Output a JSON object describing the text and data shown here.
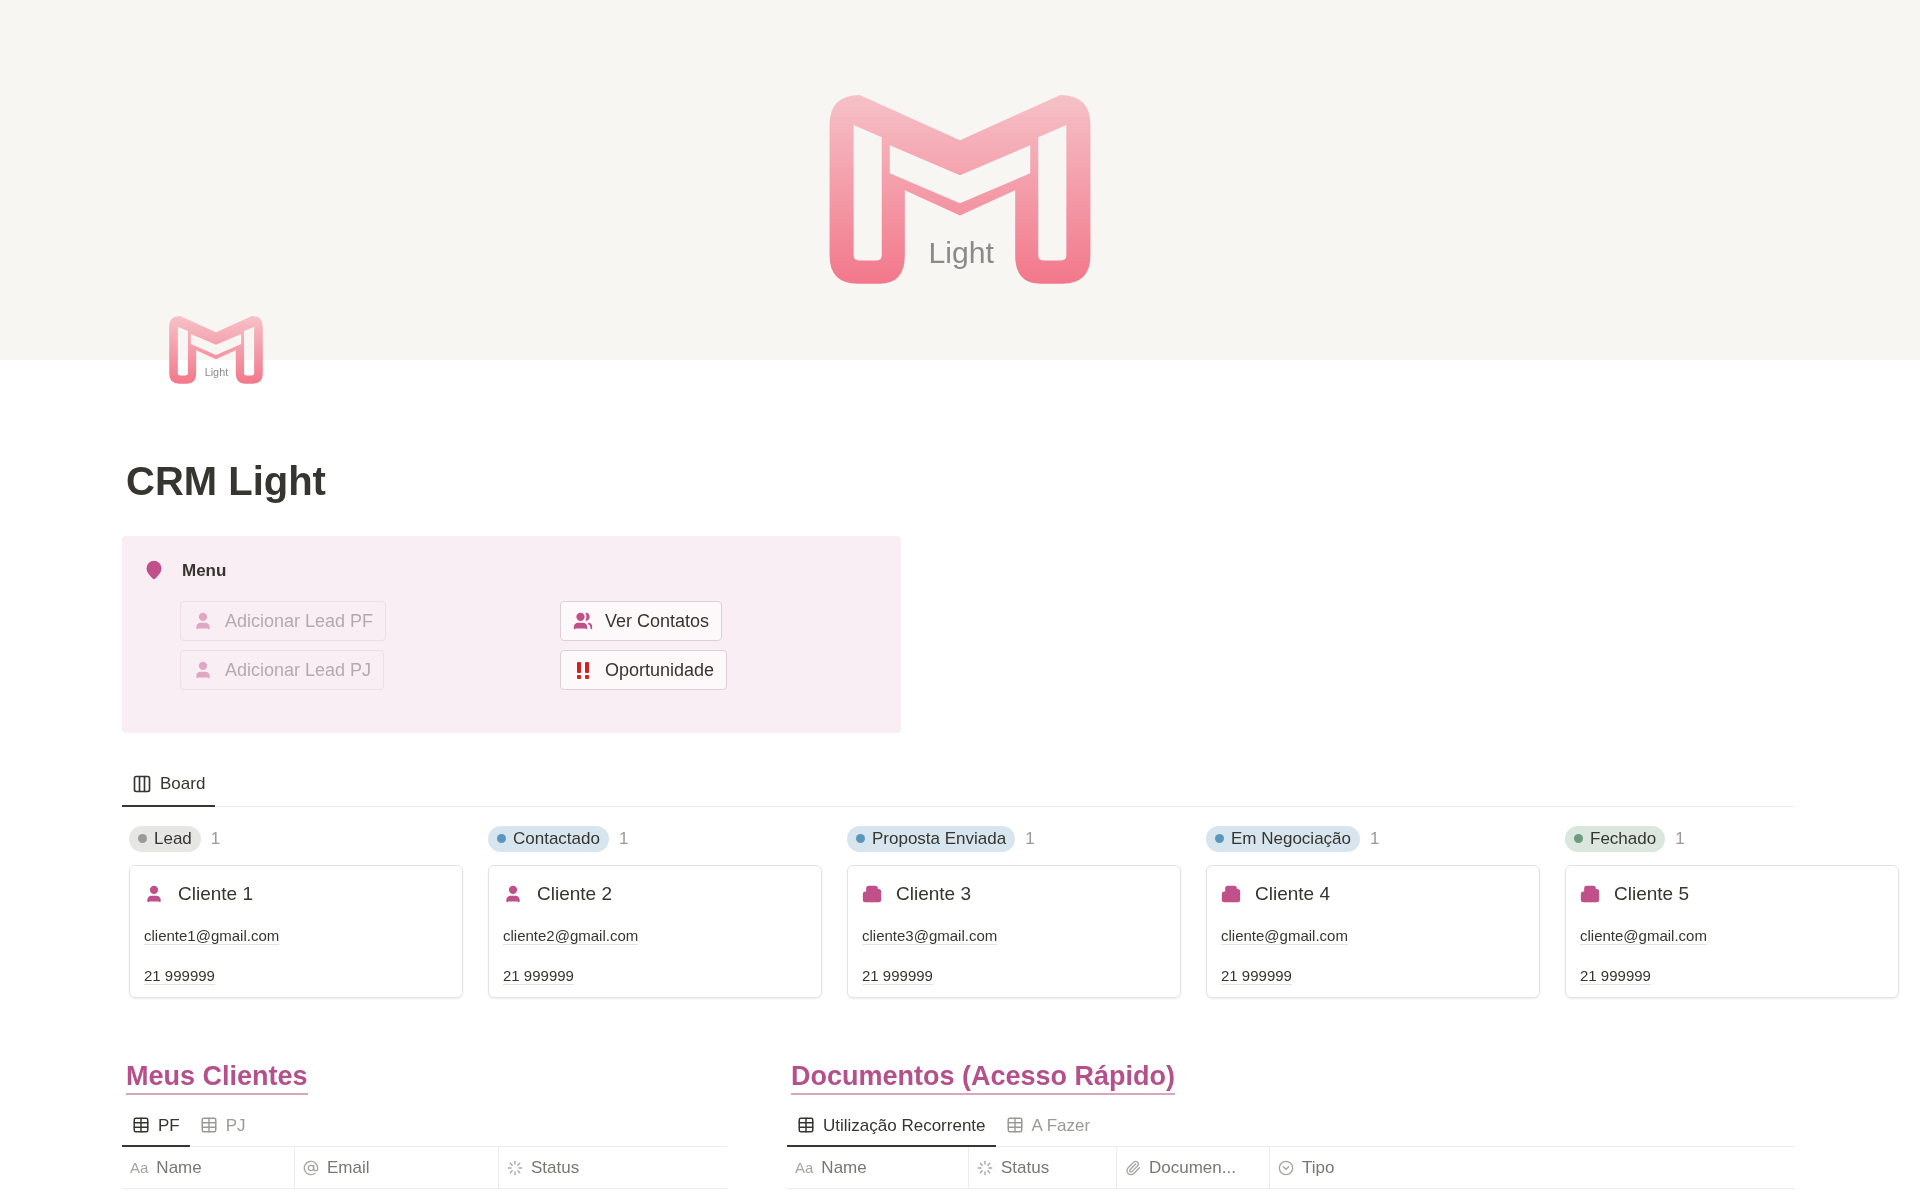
{
  "cover": {
    "logo_text": "Light"
  },
  "page_icon": {
    "logo_text": "Light"
  },
  "title": "CRM Light",
  "callout": {
    "title": "Menu",
    "buttons": [
      {
        "label": "Adicionar Lead PF",
        "kind": "person",
        "disabled": true
      },
      {
        "label": "Ver Contatos",
        "kind": "people",
        "disabled": false
      },
      {
        "label": "Adicionar Lead PJ",
        "kind": "person",
        "disabled": true
      },
      {
        "label": "Oportunidade",
        "kind": "alert",
        "disabled": false
      }
    ]
  },
  "board": {
    "tabs": [
      {
        "label": "Board",
        "selected": true
      }
    ],
    "columns": [
      {
        "status": "Lead",
        "color": "#9b9a97",
        "count": "1",
        "cards": [
          {
            "name": "Cliente 1",
            "kind": "person",
            "email": "cliente1@gmail.com",
            "phone": "21 999999"
          }
        ]
      },
      {
        "status": "Contactado",
        "color": "#5b97bd",
        "count": "1",
        "cards": [
          {
            "name": "Cliente 2",
            "kind": "person",
            "email": "cliente2@gmail.com",
            "phone": "21 999999"
          }
        ]
      },
      {
        "status": "Proposta Enviada",
        "color": "#5b97bd",
        "count": "1",
        "cards": [
          {
            "name": "Cliente 3",
            "kind": "building",
            "email": "cliente3@gmail.com",
            "phone": "21 999999"
          }
        ]
      },
      {
        "status": "Em Negociação",
        "color": "#5b97bd",
        "count": "1",
        "cards": [
          {
            "name": "Cliente 4",
            "kind": "building",
            "email": "cliente@gmail.com",
            "phone": "21 999999"
          }
        ]
      },
      {
        "status": "Fechado",
        "color": "#6c9b7d",
        "count": "1",
        "cards": [
          {
            "name": "Cliente 5",
            "kind": "building",
            "email": "cliente@gmail.com",
            "phone": "21 999999"
          }
        ]
      }
    ]
  },
  "sections": [
    {
      "title": "Meus Clientes",
      "tabs": [
        {
          "label": "PF",
          "selected": true
        },
        {
          "label": "PJ",
          "selected": false
        }
      ],
      "columns": [
        {
          "label": "Name",
          "kind": "title",
          "prefix": "Aa"
        },
        {
          "label": "Email",
          "kind": "at"
        },
        {
          "label": "Status",
          "kind": "status"
        }
      ]
    },
    {
      "title": "Documentos (Acesso Rápido)",
      "tabs": [
        {
          "label": "Utilização Recorrente",
          "selected": true
        },
        {
          "label": "A Fazer",
          "selected": false
        }
      ],
      "columns": [
        {
          "label": "Name",
          "kind": "title",
          "prefix": "Aa"
        },
        {
          "label": "Status",
          "kind": "status"
        },
        {
          "label": "Documen...",
          "kind": "clip"
        },
        {
          "label": "Tipo",
          "kind": "select"
        }
      ]
    }
  ]
}
